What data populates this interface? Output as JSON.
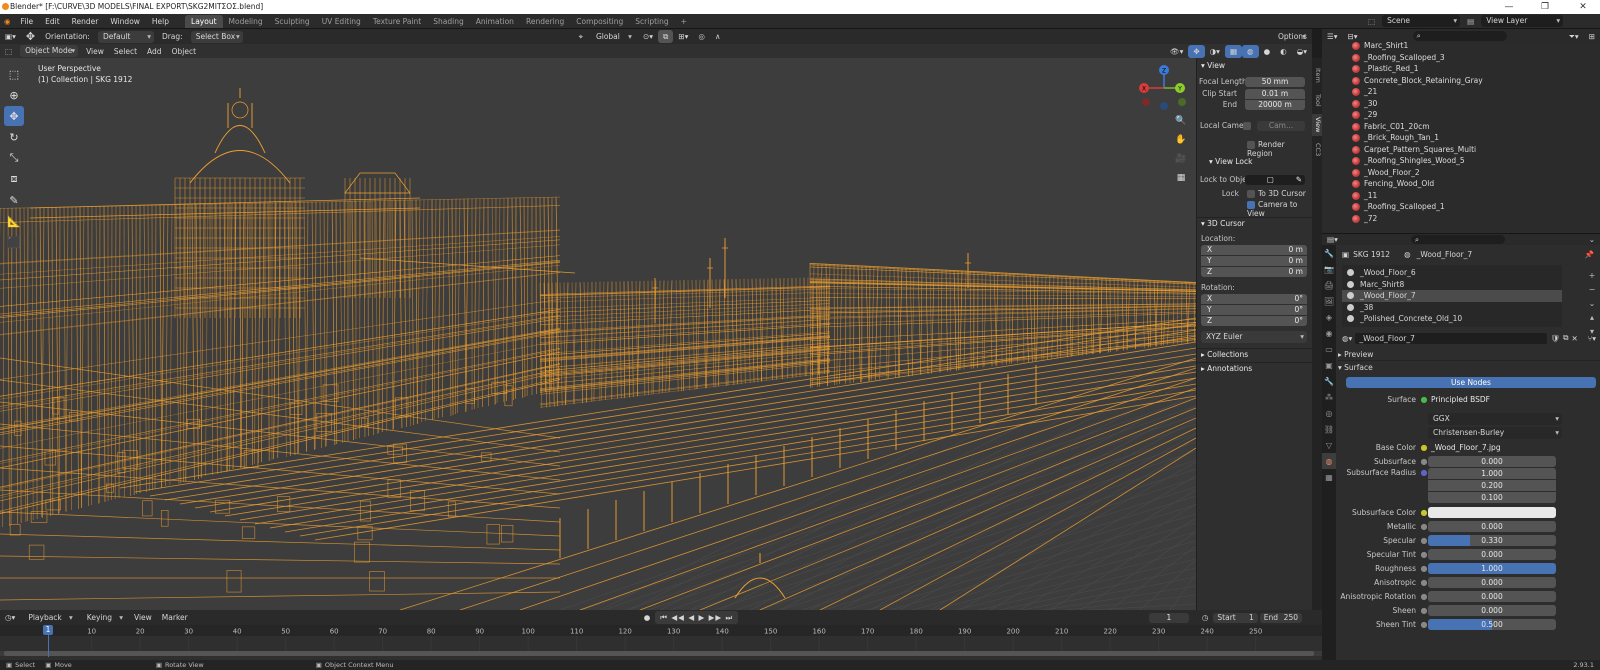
{
  "window": {
    "title": "Blender* [F:\\CURVE\\3D MODELS\\FINAL EXPORT\\SKG2MITΣΟΣ.blend]",
    "minimize": "—",
    "restore": "❐",
    "close": "✕"
  },
  "menu": {
    "items": [
      "File",
      "Edit",
      "Render",
      "Window",
      "Help"
    ],
    "workspaces": [
      "Layout",
      "Modeling",
      "Sculpting",
      "UV Editing",
      "Texture Paint",
      "Shading",
      "Animation",
      "Rendering",
      "Compositing",
      "Scripting"
    ],
    "add_tab": "+",
    "scene_label": "Scene",
    "view_layer_label": "View Layer"
  },
  "viewport_header": {
    "orientation_label": "Orientation:",
    "orientation_value": "Default",
    "drag_label": "Drag:",
    "drag_value": "Select Box",
    "transform_orientation": "Global",
    "options": "Options",
    "mode": "Object Mode",
    "menus": [
      "View",
      "Select",
      "Add",
      "Object"
    ]
  },
  "viewport": {
    "perspective": "User Perspective",
    "collection": "(1) Collection | SKG 1912",
    "gizmo": {
      "x": "X",
      "y": "Y",
      "z": "Z"
    }
  },
  "npanel": {
    "tabs": [
      "Item",
      "Tool",
      "View",
      "CC3"
    ],
    "view_section": "View",
    "focal_length_label": "Focal Length",
    "focal_length": "50 mm",
    "clip_start_label": "Clip Start",
    "clip_start": "0.01 m",
    "end_label": "End",
    "end": "20000 m",
    "local_camera_label": "Local Camer",
    "local_camera_value": "Cam...",
    "render_region": "Render Region",
    "view_lock_section": "View Lock",
    "lock_to_object_label": "Lock to Obje",
    "lock_label": "Lock",
    "to_3d_cursor": "To 3D Cursor",
    "camera_to_view": "Camera to View",
    "cursor_section": "3D Cursor",
    "location_label": "Location:",
    "rotation_label": "Rotation:",
    "loc": [
      {
        "axis": "X",
        "value": "0 m"
      },
      {
        "axis": "Y",
        "value": "0 m"
      },
      {
        "axis": "Z",
        "value": "0 m"
      }
    ],
    "rot": [
      {
        "axis": "X",
        "value": "0°"
      },
      {
        "axis": "Y",
        "value": "0°"
      },
      {
        "axis": "Z",
        "value": "0°"
      }
    ],
    "rotation_mode": "XYZ Euler",
    "collections_section": "Collections",
    "annotations_section": "Annotations"
  },
  "timeline": {
    "menus": [
      "Playback",
      "Keying",
      "View",
      "Marker"
    ],
    "current_frame": "1",
    "start_label": "Start",
    "start": "1",
    "end_label": "End",
    "end": "250",
    "ticks": [
      "10",
      "20",
      "30",
      "40",
      "50",
      "60",
      "70",
      "80",
      "90",
      "100",
      "110",
      "120",
      "130",
      "140",
      "150",
      "160",
      "170",
      "180",
      "190",
      "200",
      "210",
      "220",
      "230",
      "240",
      "250"
    ],
    "playhead": "1"
  },
  "statusbar": {
    "select": "Select",
    "move": "Move",
    "rotate": "Rotate View",
    "context": "Object Context Menu",
    "version": "2.93.1"
  },
  "outliner": {
    "items": [
      "Marc_Shirt1",
      "_Roofing_Scalloped_3",
      "_Plastic_Red_1",
      "Concrete_Block_Retaining_Gray",
      "_21",
      "_30",
      "_29",
      "Fabric_C01_20cm",
      "_Brick_Rough_Tan_1",
      "Carpet_Pattern_Squares_Multi",
      "_Roofing_Shingles_Wood_5",
      "_Wood_Floor_2",
      "Fencing_Wood_Old",
      "_11",
      "_Roofing_Scalloped_1",
      "_72"
    ]
  },
  "properties": {
    "object": "SKG 1912",
    "material": "_Wood_Floor_7",
    "slots": [
      "_Wood_Floor_6",
      "Marc_Shirt8",
      "_Wood_Floor_7",
      "_38",
      "_Polished_Concrete_Old_10"
    ],
    "material_field": "_Wood_Floor_7",
    "preview_section": "Preview",
    "surface_section": "Surface",
    "use_nodes": "Use Nodes",
    "surface_label": "Surface",
    "surface_value": "Principled BSDF",
    "distribution": "GGX",
    "subsurface_method": "Christensen-Burley",
    "base_color_label": "Base Color",
    "base_color_value": "_Wood_Floor_7.jpg",
    "subsurface_label": "Subsurface",
    "subsurface": "0.000",
    "subsurface_radius_label": "Subsurface Radius",
    "subsurface_radius": [
      "1.000",
      "0.200",
      "0.100"
    ],
    "subsurface_color_label": "Subsurface Color",
    "params": [
      {
        "label": "Metallic",
        "value": "0.000",
        "fill": 0
      },
      {
        "label": "Specular",
        "value": "0.330",
        "fill": 0.33
      },
      {
        "label": "Specular Tint",
        "value": "0.000",
        "fill": 0
      },
      {
        "label": "Roughness",
        "value": "1.000",
        "fill": 1
      },
      {
        "label": "Anisotropic",
        "value": "0.000",
        "fill": 0
      },
      {
        "label": "Anisotropic Rotation",
        "value": "0.000",
        "fill": 0
      },
      {
        "label": "Sheen",
        "value": "0.000",
        "fill": 0
      },
      {
        "label": "Sheen Tint",
        "value": "0.500",
        "fill": 0.5
      }
    ]
  },
  "colors": {
    "accent": "#4772b3",
    "wire": "#f0a030",
    "viewport_bg": "#3d3d3d"
  }
}
